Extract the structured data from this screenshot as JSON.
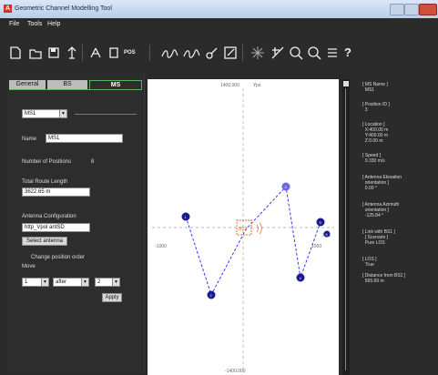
{
  "window": {
    "title": "Geometric Channel Modelling Tool"
  },
  "menu": {
    "items": [
      "File",
      "Tools",
      "Help"
    ]
  },
  "toolbar": {
    "pos_label": "POS"
  },
  "tabs": [
    {
      "label": "General"
    },
    {
      "label": "BS"
    },
    {
      "label": "MS"
    }
  ],
  "ms_panel": {
    "selected_ms": "MS1",
    "name_label": "Name",
    "name_value": "MS1",
    "num_positions_label": "Number of Positions",
    "num_positions_value": "8",
    "route_length_label": "Total Route Length",
    "route_length_value": "3622.65 m",
    "antenna_config_label": "Antenna Configuration",
    "antenna_config_value": "http_Vpol antSD",
    "select_antenna_button": "Select antenna",
    "change_order_label": "Change position order",
    "move_label": "Move",
    "move_from": "1",
    "move_mode": "after",
    "move_to": "2",
    "apply_button": "Apply"
  },
  "plot": {
    "top_label": "1400.000",
    "top_unit": "Yps",
    "left_label": "-1000",
    "right_label": "1000",
    "right_unit": "Xps",
    "bottom_label": "-1400.000",
    "bs_label": "BS1",
    "ms_point_labels": [
      "1",
      "2",
      "3",
      "4",
      "5",
      "6"
    ]
  },
  "right_panel": {
    "lines": [
      "[ MS Name ]\n  MS1",
      "[ Position ID ]\n  3",
      "[ Location ]\n  X:400.00 m\n  Y:400.00 m\n  Z:0.00 m",
      "[ Speed ]\n  0.330 m/s",
      "[ Antenna Elevation\n  orientation ]\n  0.00 °",
      "[ Antenna Azimuth\n  orientation ]\n  -125.84 °",
      "[ Link with BS1 ]\n  [ Scenario ]\n  Pure LOS",
      "[ LOS ]\n  True",
      "[ Distance from BS1 ]\n  565.69 m"
    ]
  },
  "colors": {
    "accent_green": "#5bb35b",
    "route_blue": "#3a3aff",
    "bs_orange": "#e07040"
  }
}
